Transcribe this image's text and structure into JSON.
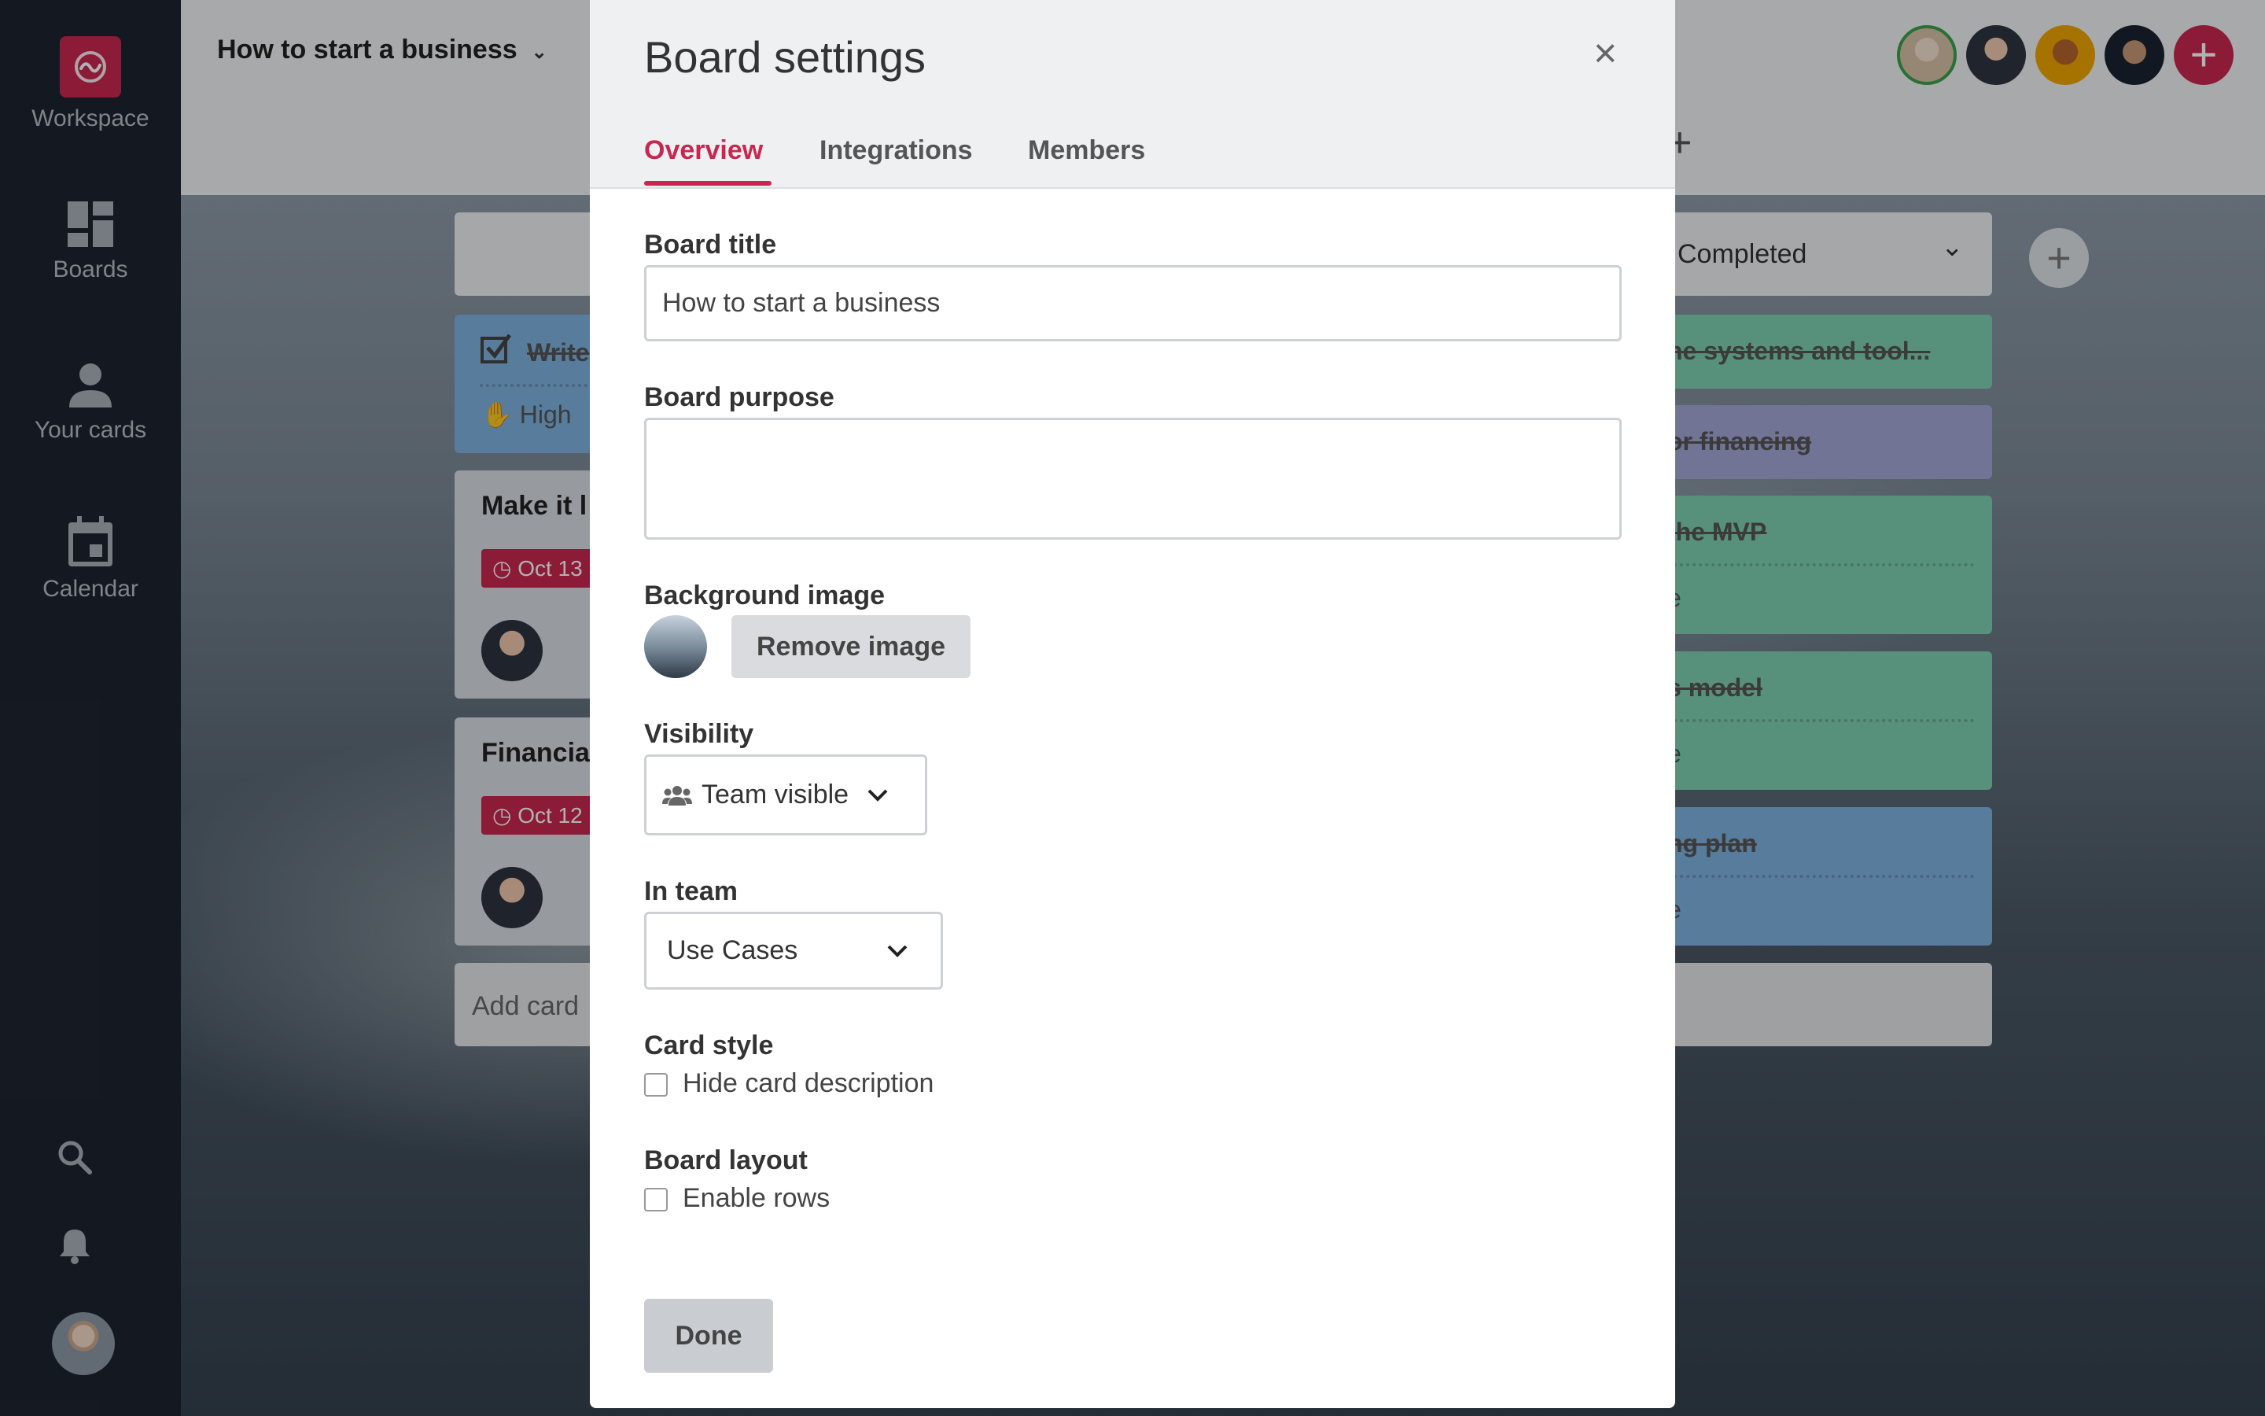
{
  "sidebar": {
    "items": [
      {
        "label": "Workspace"
      },
      {
        "label": "Boards"
      },
      {
        "label": "Your cards"
      },
      {
        "label": "Calendar"
      }
    ]
  },
  "header": {
    "board_title": "How to start a business",
    "plus": "+"
  },
  "board": {
    "column_header": "Completed",
    "add_card": "Add card",
    "left_cards": [
      {
        "title": "Write",
        "meta": "High"
      },
      {
        "title": "Make it l",
        "date": "Oct 13"
      },
      {
        "title": "Financia",
        "date": "Oct 12"
      }
    ],
    "right_cards": [
      "he systems and tool...",
      "or financing",
      "the MVP",
      "s model",
      "ng plan"
    ],
    "right_meta": [
      "e",
      "e",
      "e"
    ]
  },
  "modal": {
    "title": "Board settings",
    "close": "×",
    "tabs": [
      "Overview",
      "Integrations",
      "Members"
    ],
    "board_title_label": "Board title",
    "board_title_value": "How to start a business",
    "board_purpose_label": "Board purpose",
    "board_purpose_value": "",
    "background_label": "Background image",
    "remove_image": "Remove image",
    "visibility_label": "Visibility",
    "visibility_value": "Team visible",
    "team_label": "In team",
    "team_value": "Use Cases",
    "card_style_label": "Card style",
    "hide_description": "Hide card description",
    "board_layout_label": "Board layout",
    "enable_rows": "Enable rows",
    "done": "Done"
  },
  "colors": {
    "accent": "#c9274f",
    "sidebar": "#1d2430"
  }
}
